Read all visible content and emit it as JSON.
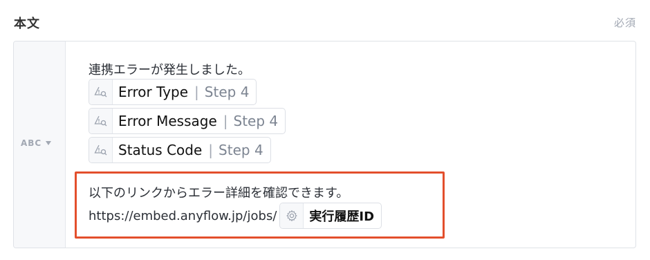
{
  "field": {
    "label": "本文",
    "required": "必須"
  },
  "editor": {
    "type_selector": "ABC",
    "intro_line": "連携エラーが発生しました。",
    "variables": [
      {
        "name": "Error Type",
        "step": "Step 4",
        "icon": "warning-search-icon"
      },
      {
        "name": "Error Message",
        "step": "Step 4",
        "icon": "warning-search-icon"
      },
      {
        "name": "Status Code",
        "step": "Step 4",
        "icon": "warning-search-icon"
      }
    ],
    "link_line": "以下のリンクからエラー詳細を確認できます。",
    "url_prefix": "https://embed.anyflow.jp/jobs/",
    "url_variable": {
      "name": "実行履歴ID",
      "icon": "gear-icon"
    }
  },
  "colors": {
    "highlight": "#e34f2c",
    "muted": "#a2a8b3"
  }
}
